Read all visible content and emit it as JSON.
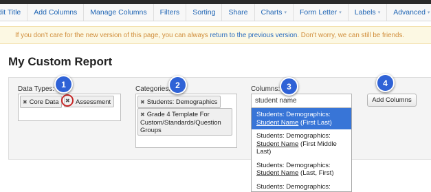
{
  "nav": {
    "items": [
      {
        "label": "dit Title",
        "dropdown": false
      },
      {
        "label": "Add Columns",
        "dropdown": false
      },
      {
        "label": "Manage Columns",
        "dropdown": false
      },
      {
        "label": "Filters",
        "dropdown": false
      },
      {
        "label": "Sorting",
        "dropdown": false
      },
      {
        "label": "Share",
        "dropdown": false
      },
      {
        "label": "Charts",
        "dropdown": true
      },
      {
        "label": "Form Letter",
        "dropdown": true
      },
      {
        "label": "Labels",
        "dropdown": true
      },
      {
        "label": "Advanced",
        "dropdown": true
      }
    ],
    "caret_glyph": "▾"
  },
  "notice": {
    "prefix": "If you don't care for the new version of this page, you can always ",
    "link": "return to the previous version",
    "suffix": ". Don't worry, we can still be friends."
  },
  "page_title": "My Custom Report",
  "data_types": {
    "label": "Data Types:",
    "chips": [
      "Core Data",
      "Assessment"
    ]
  },
  "categories": {
    "label": "Categories:",
    "chips": [
      "Students: Demographics",
      "Grade 4 Template For Custom/Standards/Question Groups"
    ]
  },
  "columns": {
    "label": "Columns:",
    "input_value": "student name",
    "options": [
      {
        "prefix": "Students: Demographics:",
        "match": "Student Name",
        "suffix": " (First Last)",
        "selected": true
      },
      {
        "prefix": "Students: Demographics:",
        "match": "Student Name",
        "suffix": " (First Middle Last)",
        "selected": false
      },
      {
        "prefix": "Students: Demographics:",
        "match": "Student Name",
        "suffix": " (Last, First)",
        "selected": false
      },
      {
        "prefix": "Students: Demographics:",
        "match": "",
        "suffix": "",
        "selected": false
      }
    ]
  },
  "add_button": "Add Columns",
  "chip_remove_glyph": "✖",
  "markers": [
    "1",
    "2",
    "3",
    "4"
  ],
  "colors": {
    "link": "#1e64b4",
    "notice_bg": "#fcf8e3",
    "notice_text": "#d08d3a",
    "marker": "#2f62d6",
    "highlight_ring": "#c62828",
    "selected_option": "#3875d7"
  }
}
